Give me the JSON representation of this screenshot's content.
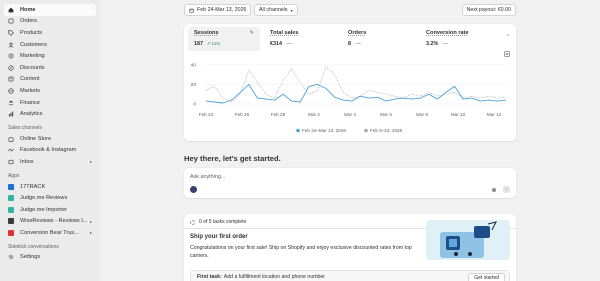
{
  "sidebar": {
    "nav": [
      {
        "label": "Home",
        "icon": "home-icon",
        "active": true
      },
      {
        "label": "Orders",
        "icon": "orders-icon"
      },
      {
        "label": "Products",
        "icon": "tag-icon"
      },
      {
        "label": "Customers",
        "icon": "person-icon"
      },
      {
        "label": "Marketing",
        "icon": "target-icon"
      },
      {
        "label": "Discounts",
        "icon": "discount-icon"
      },
      {
        "label": "Content",
        "icon": "content-icon"
      },
      {
        "label": "Markets",
        "icon": "globe-icon"
      },
      {
        "label": "Finance",
        "icon": "bank-icon"
      },
      {
        "label": "Analytics",
        "icon": "chart-icon"
      }
    ],
    "sales_channels_title": "Sales channels",
    "sales_channels": [
      {
        "label": "Online Store",
        "icon": "store-icon"
      },
      {
        "label": "Facebook & Instagram",
        "icon": "meta-icon"
      },
      {
        "label": "Inbox",
        "icon": "inbox-icon"
      }
    ],
    "apps_title": "Apps",
    "apps": [
      {
        "label": "17TRACK",
        "color": "#1f6fd8"
      },
      {
        "label": "Judge.me Reviews",
        "color": "#2fb5a3"
      },
      {
        "label": "Judge.me Importer",
        "color": "#2fb5a3"
      },
      {
        "label": "WiseReviews - Reviews I...",
        "color": "#3b3b3b"
      },
      {
        "label": "Conversion Bear Trus...",
        "color": "#e0322f"
      }
    ],
    "sidekick_title": "Sidekick conversations",
    "settings_label": "Settings"
  },
  "topbar": {
    "date_range": "Feb 24-Mar 13, 2026",
    "channels": "All channels",
    "payout": "Next payout: €0.00"
  },
  "metrics": [
    {
      "label": "Sessions",
      "value": "187",
      "change": "↗ 11%",
      "selected": true
    },
    {
      "label": "Total sales",
      "value": "€314",
      "change": "—"
    },
    {
      "label": "Orders",
      "value": "8",
      "change": "—"
    },
    {
      "label": "Conversion rate",
      "value": "3.2%",
      "change": "—"
    }
  ],
  "chart_data": {
    "type": "line",
    "y_ticks": [
      "40",
      "20",
      "0"
    ],
    "ylim": [
      0,
      45
    ],
    "x_ticks": [
      "Feb 24",
      "Feb 26",
      "Feb 28",
      "Mar 2",
      "Mar 4",
      "Mar 6",
      "Mar 8",
      "Mar 10",
      "Mar 12"
    ],
    "series": [
      {
        "name": "Feb 24–Mar 13, 2026",
        "color": "#4ba3d9",
        "style": "solid",
        "values": [
          3,
          2,
          1,
          4,
          12,
          20,
          6,
          5,
          4,
          10,
          3,
          2,
          18,
          20,
          16,
          7,
          4,
          3,
          8,
          6,
          7,
          3,
          5,
          6,
          5,
          6,
          10,
          5,
          12,
          18,
          5,
          6,
          3,
          4,
          3,
          4
        ]
      },
      {
        "name": "Feb 6–23, 2026",
        "color": "#a8a8a8",
        "style": "dashed",
        "values": [
          14,
          18,
          6,
          2,
          10,
          35,
          22,
          10,
          6,
          24,
          36,
          22,
          10,
          14,
          38,
          30,
          12,
          6,
          8,
          14,
          12,
          10,
          8,
          6,
          10,
          8,
          12,
          8,
          10,
          12,
          6,
          8,
          6,
          8,
          6,
          7
        ]
      }
    ],
    "title": "",
    "xlabel": "",
    "ylabel": ""
  },
  "greeting": "Hey there, let's get started.",
  "ask": {
    "placeholder": "Ask anything..."
  },
  "setup": {
    "count": "0 of 5 tasks complete",
    "title": "Ship your first order",
    "desc": "Congratulations on your first sale! Ship on Shopify and enjoy exclusive discounted rates from top carriers.",
    "first_task_label": "First task:",
    "first_task_text": "Add a fulfillment location and phone number",
    "cta": "Get started"
  }
}
